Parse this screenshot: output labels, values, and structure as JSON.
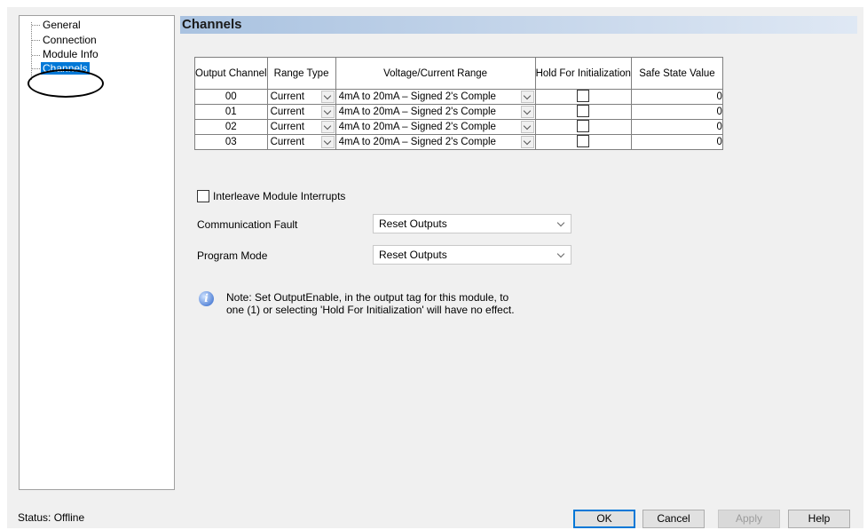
{
  "tree": {
    "items": [
      {
        "label": "General"
      },
      {
        "label": "Connection"
      },
      {
        "label": "Module Info"
      },
      {
        "label": "Channels"
      }
    ]
  },
  "panel": {
    "title": "Channels"
  },
  "table": {
    "headers": {
      "output_channel": "Output Channel",
      "range_type": "Range Type",
      "range": "Voltage/Current Range",
      "hold": "Hold For Initialization",
      "safe": "Safe State Value"
    },
    "rows": [
      {
        "channel": "00",
        "range_type": "Current",
        "range": "4mA to 20mA – Signed 2's Comple",
        "safe_value": "0"
      },
      {
        "channel": "01",
        "range_type": "Current",
        "range": "4mA to 20mA – Signed 2's Comple",
        "safe_value": "0"
      },
      {
        "channel": "02",
        "range_type": "Current",
        "range": "4mA to 20mA – Signed 2's Comple",
        "safe_value": "0"
      },
      {
        "channel": "03",
        "range_type": "Current",
        "range": "4mA to 20mA – Signed 2's Comple",
        "safe_value": "0"
      }
    ]
  },
  "form": {
    "interleave_label": "Interleave Module Interrupts",
    "comm_fault_label": "Communication Fault",
    "comm_fault_value": "Reset Outputs",
    "program_mode_label": "Program Mode",
    "program_mode_value": "Reset Outputs"
  },
  "note": {
    "icon": "info-icon",
    "text": "Note: Set OutputEnable, in the output tag for this module, to one (1) or selecting 'Hold For Initialization' will have no effect."
  },
  "footer": {
    "status": "Status: Offline",
    "ok": "OK",
    "cancel": "Cancel",
    "apply": "Apply",
    "help": "Help"
  },
  "colors": {
    "selection": "#0078d7",
    "title_bar_start": "#a9c2e0",
    "title_bar_end": "#dfe8f4"
  }
}
